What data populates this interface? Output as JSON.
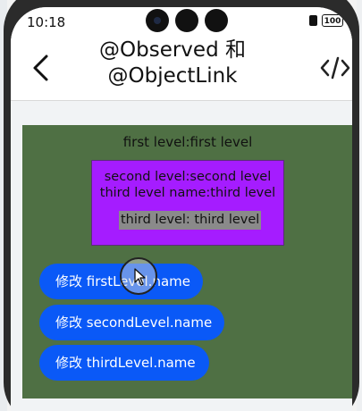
{
  "status_bar": {
    "time": "10:18",
    "battery": "100"
  },
  "navbar": {
    "title_line1": "@Observed 和",
    "title_line2": "@ObjectLink",
    "back_icon": "chevron-left-icon",
    "code_icon": "code-brackets-icon"
  },
  "content": {
    "first_level": "first level:first level",
    "second_level": "second level:second level",
    "third_level_name": "third level name:third level",
    "third_level_chip": "third level: third level"
  },
  "buttons": [
    {
      "label": "修改 firstLevel.name"
    },
    {
      "label": "修改 secondLevel.name"
    },
    {
      "label": "修改 thirdLevel.name"
    }
  ],
  "colors": {
    "panel": "#4f7044",
    "purple_box": "#a51cff",
    "button": "#0a59f7",
    "chip": "#8a8a8a"
  }
}
